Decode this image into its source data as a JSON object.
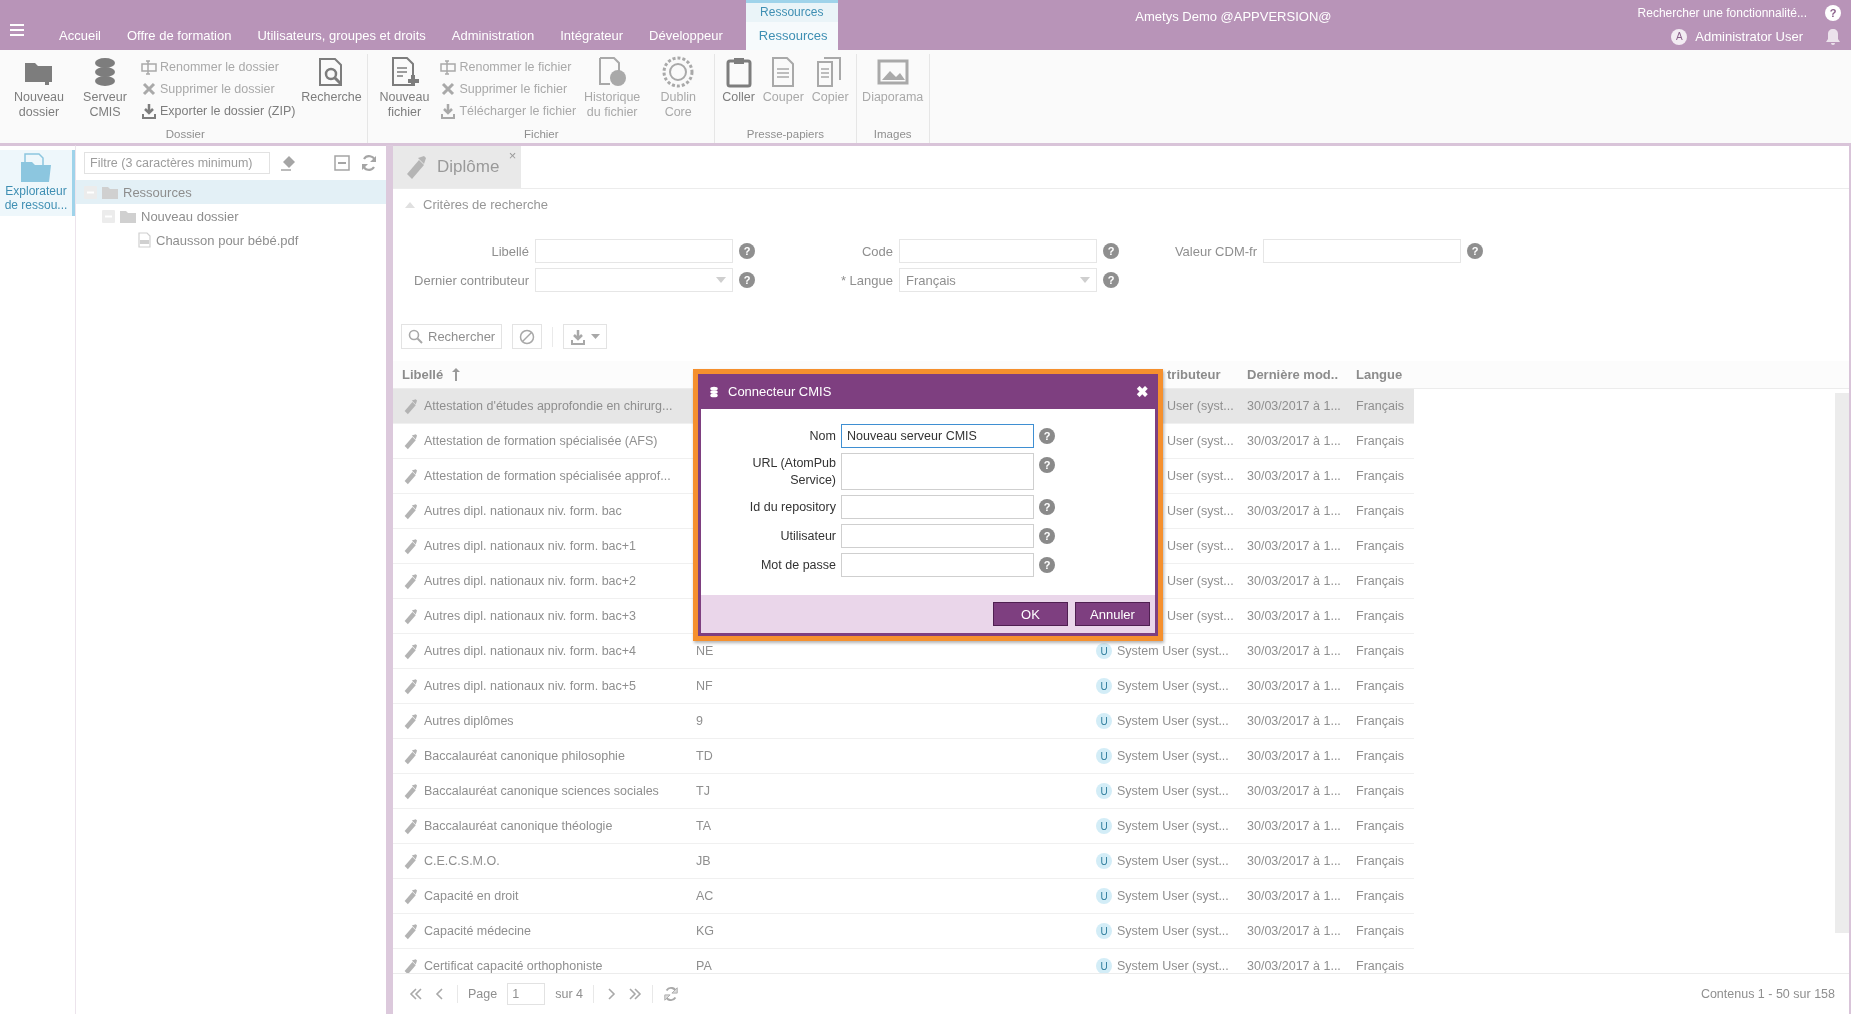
{
  "top_bar": {
    "title": "Ametys Demo @APPVERSION@",
    "tabs": [
      {
        "label": "Accueil",
        "selected": false
      },
      {
        "label": "Offre de formation",
        "selected": false
      },
      {
        "label": "Utilisateurs, groupes et droits",
        "selected": false
      },
      {
        "label": "Administration",
        "selected": false
      },
      {
        "label": "Intégrateur",
        "selected": false
      },
      {
        "label": "Développeur",
        "selected": false
      }
    ],
    "context_group": {
      "label": "Ressources",
      "tabs": [
        {
          "label": "Ressources",
          "selected": true
        }
      ]
    },
    "search": {
      "placeholder": "Rechercher une fonctionnalité...",
      "help": "?"
    },
    "user": {
      "avatar": "A",
      "name": "Administrator User"
    }
  },
  "ribbon": {
    "groups": [
      {
        "label": "Dossier",
        "items": [
          {
            "kind": "large",
            "label": "Nouveau dossier",
            "disabled": false
          },
          {
            "kind": "large",
            "label": "Serveur CMIS",
            "disabled": false
          },
          {
            "kind": "small",
            "label": "Renommer le dossier",
            "disabled": true
          },
          {
            "kind": "small",
            "label": "Supprimer le dossier",
            "disabled": true
          },
          {
            "kind": "small",
            "label": "Exporter le dossier (ZIP)",
            "disabled": false
          },
          {
            "kind": "large",
            "label": "Recherche",
            "disabled": false
          }
        ]
      },
      {
        "label": "Fichier",
        "items": [
          {
            "kind": "large",
            "label": "Nouveau fichier",
            "disabled": false
          },
          {
            "kind": "small",
            "label": "Renommer le fichier",
            "disabled": true
          },
          {
            "kind": "small",
            "label": "Supprimer le fichier",
            "disabled": true
          },
          {
            "kind": "small",
            "label": "Télécharger le fichier",
            "disabled": true
          },
          {
            "kind": "large",
            "label": "Historique du fichier",
            "disabled": true
          },
          {
            "kind": "large",
            "label": "Dublin Core",
            "disabled": true
          }
        ]
      },
      {
        "label": "Presse-papiers",
        "items": [
          {
            "kind": "large",
            "label": "Coller",
            "disabled": false
          },
          {
            "kind": "large",
            "label": "Couper",
            "disabled": true
          },
          {
            "kind": "large",
            "label": "Copier",
            "disabled": true
          }
        ]
      },
      {
        "label": "Images",
        "items": [
          {
            "kind": "large",
            "label": "Diaporama",
            "disabled": true
          }
        ]
      }
    ]
  },
  "tool_strip": [
    {
      "label": "Explorateur de ressou...",
      "selected": true
    }
  ],
  "explorer": {
    "filter": {
      "placeholder": "Filtre (3 caractères minimum)"
    },
    "tree": [
      {
        "kind": "folder",
        "label": "Ressources",
        "selected": true,
        "expanded": true,
        "children": [
          {
            "kind": "folder",
            "label": "Nouveau dossier",
            "selected": false,
            "expanded": true,
            "children": [
              {
                "kind": "pdf",
                "label": "Chausson pour bébé.pdf",
                "selected": false
              }
            ]
          }
        ]
      }
    ]
  },
  "main": {
    "tabs": [
      {
        "label": "Diplôme",
        "selected": true,
        "close": "×"
      }
    ],
    "criteria": {
      "title": "Critères de recherche",
      "expanded": true,
      "fields": [
        {
          "kind": "text",
          "label": "Libellé",
          "help": "?"
        },
        {
          "kind": "text",
          "label": "Code",
          "help": "?"
        },
        {
          "kind": "text",
          "label": "Valeur CDM-fr",
          "help": "?"
        },
        {
          "kind": "combo",
          "label": "Dernier contributeur",
          "help": "?"
        },
        {
          "kind": "combo",
          "label": "* Langue",
          "value": "Français",
          "help": "?"
        }
      ]
    },
    "actions": {
      "search": "Rechercher"
    },
    "grid": {
      "columns": [
        {
          "kind": "label",
          "label": "Libellé",
          "sorted": true
        },
        {
          "kind": "code"
        },
        {
          "kind": "contributor",
          "label": "tributeur"
        },
        {
          "kind": "date",
          "label": "Dernière mod.."
        },
        {
          "kind": "language",
          "label": "Langue"
        }
      ],
      "rows": [
        {
          "label": "Attestation d'études approfondie en chirurg...",
          "contributor": "User (syst...",
          "date": "30/03/2017 à 1...",
          "language": "Français",
          "selected": true
        },
        {
          "label": "Attestation de formation spécialisée (AFS)",
          "contributor": "User (syst...",
          "date": "30/03/2017 à 1...",
          "language": "Français",
          "selected": false
        },
        {
          "label": "Attestation de formation spécialisée approf...",
          "contributor": "User (syst...",
          "date": "30/03/2017 à 1...",
          "language": "Français",
          "selected": false
        },
        {
          "label": "Autres dipl. nationaux niv. form. bac",
          "contributor": "User (syst...",
          "date": "30/03/2017 à 1...",
          "language": "Français",
          "selected": false
        },
        {
          "label": "Autres dipl. nationaux niv. form. bac+1",
          "contributor": "User (syst...",
          "date": "30/03/2017 à 1...",
          "language": "Français",
          "selected": false
        },
        {
          "label": "Autres dipl. nationaux niv. form. bac+2",
          "contributor": "User (syst...",
          "date": "30/03/2017 à 1...",
          "language": "Français",
          "selected": false
        },
        {
          "label": "Autres dipl. nationaux niv. form. bac+3",
          "contributor": "User (syst...",
          "date": "30/03/2017 à 1...",
          "language": "Français",
          "selected": false
        },
        {
          "label": "Autres dipl. nationaux niv. form. bac+4",
          "code": "NE",
          "avatar": "U",
          "contributor": "System User (syst...",
          "date": "30/03/2017 à 1...",
          "language": "Français",
          "selected": false
        },
        {
          "label": "Autres dipl. nationaux niv. form. bac+5",
          "code": "NF",
          "avatar": "U",
          "contributor": "System User (syst...",
          "date": "30/03/2017 à 1...",
          "language": "Français",
          "selected": false
        },
        {
          "label": "Autres diplômes",
          "code": "9",
          "avatar": "U",
          "contributor": "System User (syst...",
          "date": "30/03/2017 à 1...",
          "language": "Français",
          "selected": false
        },
        {
          "label": "Baccalauréat canonique philosophie",
          "code": "TD",
          "avatar": "U",
          "contributor": "System User (syst...",
          "date": "30/03/2017 à 1...",
          "language": "Français",
          "selected": false
        },
        {
          "label": "Baccalauréat canonique sciences sociales",
          "code": "TJ",
          "avatar": "U",
          "contributor": "System User (syst...",
          "date": "30/03/2017 à 1...",
          "language": "Français",
          "selected": false
        },
        {
          "label": "Baccalauréat canonique théologie",
          "code": "TA",
          "avatar": "U",
          "contributor": "System User (syst...",
          "date": "30/03/2017 à 1...",
          "language": "Français",
          "selected": false
        },
        {
          "label": "C.E.C.S.M.O.",
          "code": "JB",
          "avatar": "U",
          "contributor": "System User (syst...",
          "date": "30/03/2017 à 1...",
          "language": "Français",
          "selected": false
        },
        {
          "label": "Capacité en droit",
          "code": "AC",
          "avatar": "U",
          "contributor": "System User (syst...",
          "date": "30/03/2017 à 1...",
          "language": "Français",
          "selected": false
        },
        {
          "label": "Capacité médecine",
          "code": "KG",
          "avatar": "U",
          "contributor": "System User (syst...",
          "date": "30/03/2017 à 1...",
          "language": "Français",
          "selected": false
        },
        {
          "label": "Certificat capacité orthophoniste",
          "code": "PA",
          "avatar": "U",
          "contributor": "System User (syst...",
          "date": "30/03/2017 à 1...",
          "language": "Français",
          "selected": false
        }
      ]
    },
    "pager": {
      "page_label": "Page",
      "page": "1",
      "total": "sur 4",
      "summary": "Contenus 1 - 50 sur 158"
    }
  },
  "dialog": {
    "title": "Connecteur CMIS",
    "close": "✖",
    "fields": [
      {
        "kind": "text",
        "label": "Nom",
        "value": "Nouveau serveur CMIS",
        "focused": true,
        "help": "?"
      },
      {
        "kind": "textarea",
        "label": "URL (AtomPub Service)",
        "focused": false,
        "help": "?"
      },
      {
        "kind": "text",
        "label": "Id du repository",
        "focused": false,
        "help": "?"
      },
      {
        "kind": "text",
        "label": "Utilisateur",
        "focused": false,
        "help": "?"
      },
      {
        "kind": "text",
        "label": "Mot de passe",
        "focused": false,
        "help": "?"
      }
    ],
    "buttons": [
      "OK",
      "Annuler"
    ]
  }
}
